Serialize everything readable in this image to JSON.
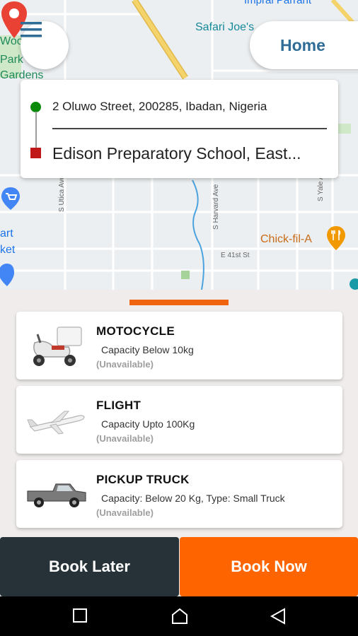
{
  "map": {
    "labels": {
      "safari": "Safari Joe's",
      "park_line1": "Wood",
      "park_line2": "Park",
      "gardens": "Gardens",
      "chickfila": "Chick-fil-A",
      "mart_line1": "art",
      "mart_line2": "ket",
      "top_partial": "Imprai Parrant"
    },
    "streets": {
      "utica": "S Utica Ave",
      "harvard": "S Harvard Ave",
      "yale": "S Yale Ave",
      "e41": "E 41st St"
    },
    "colors": {
      "road": "#f4d36a",
      "road_border": "#e0b84a",
      "water": "#4aa3df",
      "pin": "#e94235",
      "poi_blue": "#1a73e8",
      "poi_orange": "#e8711a"
    }
  },
  "header": {
    "menu_icon": "hamburger-menu-icon",
    "home_label": "Home"
  },
  "route": {
    "from": "2 Oluwo Street, 200285, Ibadan, Nigeria",
    "to": "Edison Preparatory School, East..."
  },
  "vehicles": [
    {
      "icon": "scooter-icon",
      "name": "MOTOCYCLE",
      "capacity": "Capacity Below 10kg",
      "status": "(Unavailable)"
    },
    {
      "icon": "airplane-icon",
      "name": "FLIGHT",
      "capacity": "Capacity Upto 100Kg",
      "status": "(Unavailable)"
    },
    {
      "icon": "pickup-truck-icon",
      "name": "PICKUP TRUCK",
      "capacity": "Capacity: Below 20 Kg, Type: Small Truck",
      "status": "(Unavailable)"
    }
  ],
  "actions": {
    "book_later": "Book Later",
    "book_now": "Book Now"
  },
  "theme": {
    "accent": "#fe6500",
    "dark": "#263238",
    "home_text": "#2f6d96"
  }
}
